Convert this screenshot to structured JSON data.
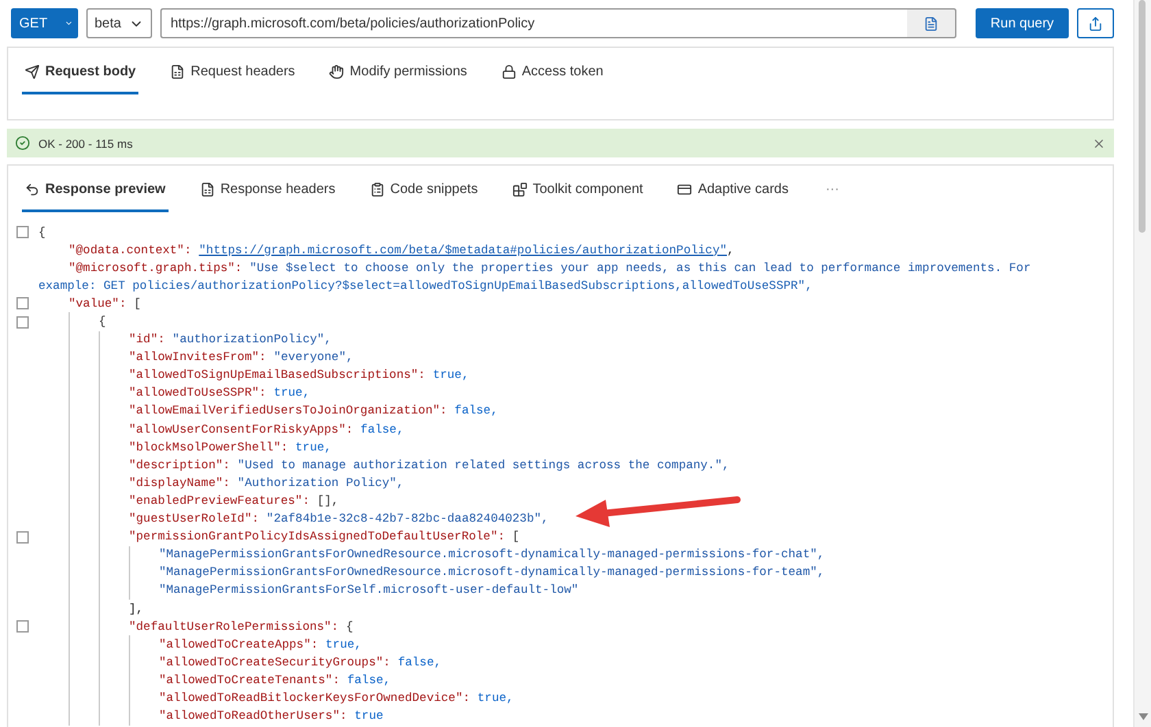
{
  "query_bar": {
    "method": "GET",
    "version": "beta",
    "url": "https://graph.microsoft.com/beta/policies/authorizationPolicy",
    "run_label": "Run query"
  },
  "request_tabs": [
    {
      "label": "Request body",
      "selected": true
    },
    {
      "label": "Request headers",
      "selected": false
    },
    {
      "label": "Modify permissions",
      "selected": false
    },
    {
      "label": "Access token",
      "selected": false
    }
  ],
  "status": {
    "message": "OK - 200 - 115 ms"
  },
  "response_tabs": [
    {
      "label": "Response preview",
      "selected": true
    },
    {
      "label": "Response headers",
      "selected": false
    },
    {
      "label": "Code snippets",
      "selected": false
    },
    {
      "label": "Toolkit component",
      "selected": false
    },
    {
      "label": "Adaptive cards",
      "selected": false
    }
  ],
  "more_label": "···",
  "code": [
    {
      "value": "{",
      "kind": "punct",
      "foldable": true,
      "children": [
        {
          "key": "\"@odata.context\":",
          "value": "\"https://graph.microsoft.com/beta/$metadata#policies/authorizationPolicy\"",
          "kind": "link",
          "tail": ","
        },
        {
          "key": "\"@microsoft.graph.tips\":",
          "value": "\"Use $select to choose only the properties your app needs, as this can lead to performance improvements. For",
          "kind": "string",
          "continuation": "example: GET policies/authorizationPolicy?$select=allowedToSignUpEmailBasedSubscriptions,allowedToUseSSPR\","
        },
        {
          "key": "\"value\":",
          "value": "[",
          "kind": "punct",
          "foldable": true,
          "children": [
            {
              "value": "{",
              "kind": "punct",
              "foldable": true,
              "children": [
                {
                  "key": "\"id\":",
                  "value": "\"authorizationPolicy\",",
                  "kind": "string"
                },
                {
                  "key": "\"allowInvitesFrom\":",
                  "value": "\"everyone\",",
                  "kind": "string"
                },
                {
                  "key": "\"allowedToSignUpEmailBasedSubscriptions\":",
                  "value": "true,",
                  "kind": "literal"
                },
                {
                  "key": "\"allowedToUseSSPR\":",
                  "value": "true,",
                  "kind": "literal"
                },
                {
                  "key": "\"allowEmailVerifiedUsersToJoinOrganization\":",
                  "value": "false,",
                  "kind": "literal"
                },
                {
                  "key": "\"allowUserConsentForRiskyApps\":",
                  "value": "false,",
                  "kind": "literal"
                },
                {
                  "key": "\"blockMsolPowerShell\":",
                  "value": "true,",
                  "kind": "literal"
                },
                {
                  "key": "\"description\":",
                  "value": "\"Used to manage authorization related settings across the company.\",",
                  "kind": "string"
                },
                {
                  "key": "\"displayName\":",
                  "value": "\"Authorization Policy\",",
                  "kind": "string"
                },
                {
                  "key": "\"enabledPreviewFeatures\":",
                  "value": "[],",
                  "kind": "punct"
                },
                {
                  "key": "\"guestUserRoleId\":",
                  "value": "\"2af84b1e-32c8-42b7-82bc-daa82404023b\",",
                  "kind": "string"
                },
                {
                  "key": "\"permissionGrantPolicyIdsAssignedToDefaultUserRole\":",
                  "value": "[",
                  "kind": "punct",
                  "foldable": true,
                  "close": "],",
                  "children": [
                    {
                      "value": "\"ManagePermissionGrantsForOwnedResource.microsoft-dynamically-managed-permissions-for-chat\",",
                      "kind": "string"
                    },
                    {
                      "value": "\"ManagePermissionGrantsForOwnedResource.microsoft-dynamically-managed-permissions-for-team\",",
                      "kind": "string"
                    },
                    {
                      "value": "\"ManagePermissionGrantsForSelf.microsoft-user-default-low\"",
                      "kind": "string"
                    }
                  ]
                },
                {
                  "key": "\"defaultUserRolePermissions\":",
                  "value": "{",
                  "kind": "punct",
                  "foldable": true,
                  "children": [
                    {
                      "key": "\"allowedToCreateApps\":",
                      "value": "true,",
                      "kind": "literal"
                    },
                    {
                      "key": "\"allowedToCreateSecurityGroups\":",
                      "value": "false,",
                      "kind": "literal"
                    },
                    {
                      "key": "\"allowedToCreateTenants\":",
                      "value": "false,",
                      "kind": "literal"
                    },
                    {
                      "key": "\"allowedToReadBitlockerKeysForOwnedDevice\":",
                      "value": "true,",
                      "kind": "literal"
                    },
                    {
                      "key": "\"allowedToReadOtherUsers\":",
                      "value": "true",
                      "kind": "literal"
                    }
                  ]
                }
              ]
            }
          ]
        }
      ]
    }
  ]
}
